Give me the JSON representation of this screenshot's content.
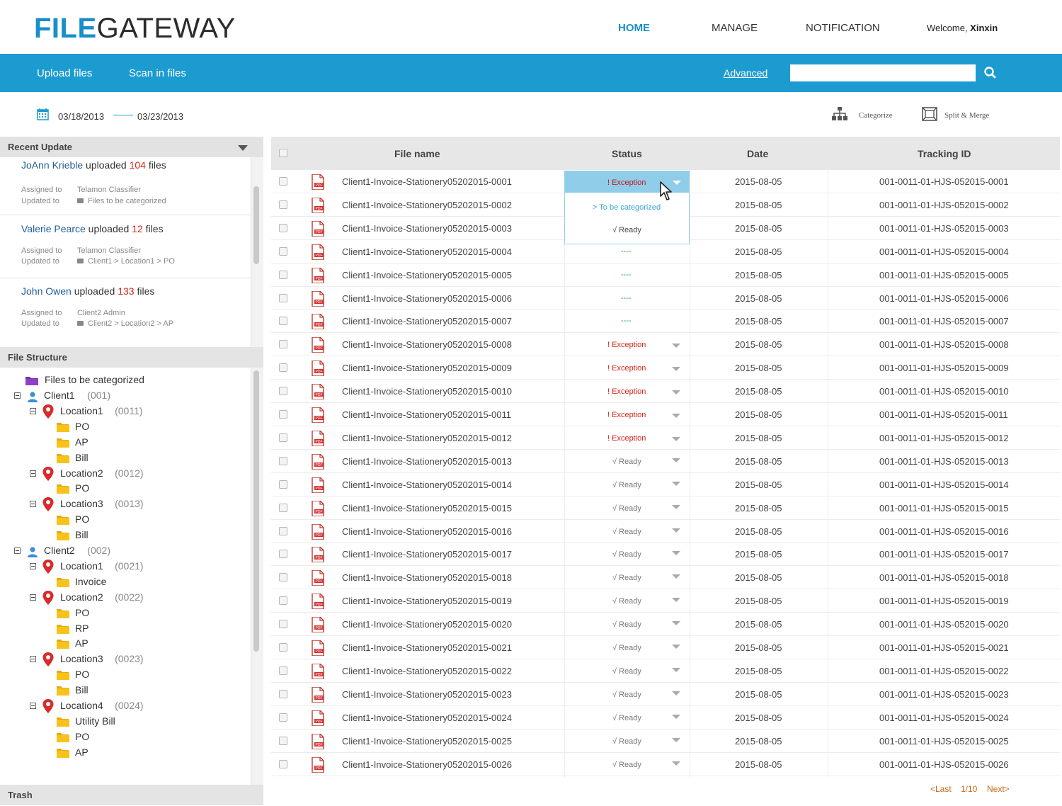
{
  "header": {
    "logo_part1": "FILE",
    "logo_part2": "GATEWAY",
    "nav": [
      "HOME",
      "MANAGE",
      "NOTIFICATION"
    ],
    "welcome_prefix": "Welcome, ",
    "welcome_user": "Xinxin"
  },
  "toolbar": {
    "upload": "Upload files",
    "scan": "Scan in files",
    "advanced": "Advanced",
    "search_value": ""
  },
  "daterange": {
    "from": "03/18/2013",
    "to": "03/23/2013"
  },
  "actions": {
    "categorize": "Categorize",
    "split_merge": "Split & Merge"
  },
  "recent": {
    "title": "Recent Update",
    "assigned_label": "Assigned to",
    "updated_label": "Updated to",
    "items": [
      {
        "name": "JoAnn Krieble",
        "verb": " uploaded ",
        "count": "104",
        "suffix": " files",
        "assigned": "Telamon Classifier",
        "updated": "Files to be categorized"
      },
      {
        "name": "Valerie Pearce",
        "verb": " uploaded ",
        "count": "12",
        "suffix": " files",
        "assigned": "Telamon Classifier",
        "updated": "Client1 > Location1 > PO"
      },
      {
        "name": "John Owen",
        "verb": " uploaded ",
        "count": "133",
        "suffix": " files",
        "assigned": "Client2 Admin",
        "updated": "Client2 > Location2 > AP"
      }
    ]
  },
  "structure": {
    "title": "File Structure",
    "root": "Files to be categorized",
    "nodes": [
      {
        "type": "client",
        "label": "Client1",
        "code": "(001)"
      },
      {
        "type": "location",
        "label": "Location1",
        "code": "(0011)"
      },
      {
        "type": "folder",
        "label": "PO"
      },
      {
        "type": "folder",
        "label": "AP"
      },
      {
        "type": "folder",
        "label": "Bill"
      },
      {
        "type": "location",
        "label": "Location2",
        "code": "(0012)"
      },
      {
        "type": "folder",
        "label": "PO"
      },
      {
        "type": "location",
        "label": "Location3",
        "code": "(0013)"
      },
      {
        "type": "folder",
        "label": "PO"
      },
      {
        "type": "folder",
        "label": "Bill"
      },
      {
        "type": "client",
        "label": "Client2",
        "code": "(002)"
      },
      {
        "type": "location",
        "label": "Location1",
        "code": "(0021)"
      },
      {
        "type": "folder",
        "label": "Invoice"
      },
      {
        "type": "location",
        "label": "Location2",
        "code": "(0022)"
      },
      {
        "type": "folder",
        "label": "PO"
      },
      {
        "type": "folder",
        "label": "RP"
      },
      {
        "type": "folder",
        "label": "AP"
      },
      {
        "type": "location",
        "label": "Location3",
        "code": "(0023)"
      },
      {
        "type": "folder",
        "label": "PO"
      },
      {
        "type": "folder",
        "label": "Bill"
      },
      {
        "type": "location",
        "label": "Location4",
        "code": "(0024)"
      },
      {
        "type": "folder",
        "label": "Utility Bill"
      },
      {
        "type": "folder",
        "label": "PO"
      },
      {
        "type": "folder",
        "label": "AP"
      }
    ]
  },
  "trash": {
    "title": "Trash"
  },
  "table": {
    "columns": [
      "File name",
      "Status",
      "Date",
      "Tracking ID"
    ],
    "rows": [
      {
        "file": "Client1-Invoice-Stationery05202015-0001",
        "status": "! Exception",
        "kind": "exception",
        "date": "2015-08-05",
        "tracking": "001-0011-01-HJS-052015-0001"
      },
      {
        "file": "Client1-Invoice-Stationery05202015-0002",
        "status": "",
        "kind": "none",
        "date": "2015-08-05",
        "tracking": "001-0011-01-HJS-052015-0002"
      },
      {
        "file": "Client1-Invoice-Stationery05202015-0003",
        "status": "",
        "kind": "none",
        "date": "2015-08-05",
        "tracking": "001-0011-01-HJS-052015-0003"
      },
      {
        "file": "Client1-Invoice-Stationery05202015-0004",
        "status": "----",
        "kind": "dash",
        "date": "2015-08-05",
        "tracking": "001-0011-01-HJS-052015-0004"
      },
      {
        "file": "Client1-Invoice-Stationery05202015-0005",
        "status": "----",
        "kind": "dash",
        "date": "2015-08-05",
        "tracking": "001-0011-01-HJS-052015-0005"
      },
      {
        "file": "Client1-Invoice-Stationery05202015-0006",
        "status": "----",
        "kind": "dash",
        "date": "2015-08-05",
        "tracking": "001-0011-01-HJS-052015-0006"
      },
      {
        "file": "Client1-Invoice-Stationery05202015-0007",
        "status": "----",
        "kind": "dash",
        "date": "2015-08-05",
        "tracking": "001-0011-01-HJS-052015-0007"
      },
      {
        "file": "Client1-Invoice-Stationery05202015-0008",
        "status": "! Exception",
        "kind": "exception",
        "date": "2015-08-05",
        "tracking": "001-0011-01-HJS-052015-0008"
      },
      {
        "file": "Client1-Invoice-Stationery05202015-0009",
        "status": "! Exception",
        "kind": "exception",
        "date": "2015-08-05",
        "tracking": "001-0011-01-HJS-052015-0009"
      },
      {
        "file": "Client1-Invoice-Stationery05202015-0010",
        "status": "! Exception",
        "kind": "exception",
        "date": "2015-08-05",
        "tracking": "001-0011-01-HJS-052015-0010"
      },
      {
        "file": "Client1-Invoice-Stationery05202015-0011",
        "status": "! Exception",
        "kind": "exception",
        "date": "2015-08-05",
        "tracking": "001-0011-01-HJS-052015-0011"
      },
      {
        "file": "Client1-Invoice-Stationery05202015-0012",
        "status": "! Exception",
        "kind": "exception",
        "date": "2015-08-05",
        "tracking": "001-0011-01-HJS-052015-0012"
      },
      {
        "file": "Client1-Invoice-Stationery05202015-0013",
        "status": "√ Ready",
        "kind": "ready",
        "date": "2015-08-05",
        "tracking": "001-0011-01-HJS-052015-0013"
      },
      {
        "file": "Client1-Invoice-Stationery05202015-0014",
        "status": "√ Ready",
        "kind": "ready",
        "date": "2015-08-05",
        "tracking": "001-0011-01-HJS-052015-0014"
      },
      {
        "file": "Client1-Invoice-Stationery05202015-0015",
        "status": "√ Ready",
        "kind": "ready",
        "date": "2015-08-05",
        "tracking": "001-0011-01-HJS-052015-0015"
      },
      {
        "file": "Client1-Invoice-Stationery05202015-0016",
        "status": "√ Ready",
        "kind": "ready",
        "date": "2015-08-05",
        "tracking": "001-0011-01-HJS-052015-0016"
      },
      {
        "file": "Client1-Invoice-Stationery05202015-0017",
        "status": "√ Ready",
        "kind": "ready",
        "date": "2015-08-05",
        "tracking": "001-0011-01-HJS-052015-0017"
      },
      {
        "file": "Client1-Invoice-Stationery05202015-0018",
        "status": "√ Ready",
        "kind": "ready",
        "date": "2015-08-05",
        "tracking": "001-0011-01-HJS-052015-0018"
      },
      {
        "file": "Client1-Invoice-Stationery05202015-0019",
        "status": "√ Ready",
        "kind": "ready",
        "date": "2015-08-05",
        "tracking": "001-0011-01-HJS-052015-0019"
      },
      {
        "file": "Client1-Invoice-Stationery05202015-0020",
        "status": "√ Ready",
        "kind": "ready",
        "date": "2015-08-05",
        "tracking": "001-0011-01-HJS-052015-0020"
      },
      {
        "file": "Client1-Invoice-Stationery05202015-0021",
        "status": "√ Ready",
        "kind": "ready",
        "date": "2015-08-05",
        "tracking": "001-0011-01-HJS-052015-0021"
      },
      {
        "file": "Client1-Invoice-Stationery05202015-0022",
        "status": "√ Ready",
        "kind": "ready",
        "date": "2015-08-05",
        "tracking": "001-0011-01-HJS-052015-0022"
      },
      {
        "file": "Client1-Invoice-Stationery05202015-0023",
        "status": "√ Ready",
        "kind": "ready",
        "date": "2015-08-05",
        "tracking": "001-0011-01-HJS-052015-0023"
      },
      {
        "file": "Client1-Invoice-Stationery05202015-0024",
        "status": "√ Ready",
        "kind": "ready",
        "date": "2015-08-05",
        "tracking": "001-0011-01-HJS-052015-0024"
      },
      {
        "file": "Client1-Invoice-Stationery05202015-0025",
        "status": "√ Ready",
        "kind": "ready",
        "date": "2015-08-05",
        "tracking": "001-0011-01-HJS-052015-0025"
      },
      {
        "file": "Client1-Invoice-Stationery05202015-0026",
        "status": "√ Ready",
        "kind": "ready",
        "date": "2015-08-05",
        "tracking": "001-0011-01-HJS-052015-0026"
      }
    ],
    "dropdown": {
      "selected": "! Exception",
      "options": [
        "> To be categorized",
        "√ Ready"
      ]
    }
  },
  "pager": {
    "last": "<Last",
    "page": "1/10",
    "next": "Next>"
  },
  "colors": {
    "brand_blue": "#1c9bd1",
    "exception_red": "#d9261c",
    "dash_green": "#27a33a",
    "folder_yellow": "#f7c31a",
    "pin_red": "#d92b2b"
  }
}
